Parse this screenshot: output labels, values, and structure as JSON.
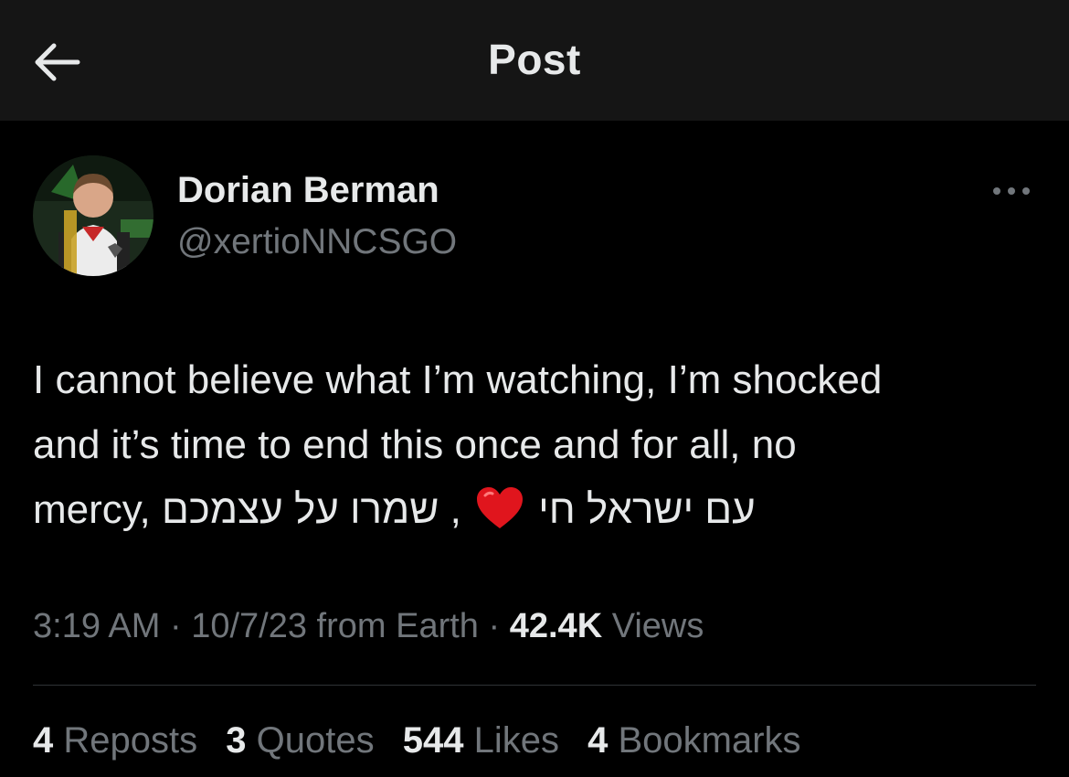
{
  "header": {
    "title": "Post",
    "back_icon": "arrow-left-icon"
  },
  "author": {
    "display_name": "Dorian Berman",
    "handle": "@xertioNNCSGO",
    "avatar_icon": "avatar-photo"
  },
  "post": {
    "line1": "I cannot believe what I’m watching, I’m shocked",
    "line2": "and it’s time to end this once and for all, no",
    "line3_start": "mercy, ",
    "line3_hebrew1": "שמרו על עצמכם",
    "line3_comma": " , ",
    "line3_hebrew2": "עם ישראל חי",
    "emoji": "heart-emoji"
  },
  "meta": {
    "time": "3:19 AM",
    "sep1": " · ",
    "date": "10/7/23",
    "location": " from Earth",
    "sep2": " · ",
    "views_count": "42.4K",
    "views_label": " Views"
  },
  "stats": {
    "reposts": {
      "count": "4",
      "label": "Reposts"
    },
    "quotes": {
      "count": "3",
      "label": "Quotes"
    },
    "likes": {
      "count": "544",
      "label": "Likes"
    },
    "bookmarks": {
      "count": "4",
      "label": "Bookmarks"
    }
  },
  "colors": {
    "background": "#000000",
    "header_bg": "#151515",
    "primary_text": "#e7e9ea",
    "secondary_text": "#71767b",
    "divider": "#2f3336",
    "heart": "#e0151d"
  }
}
